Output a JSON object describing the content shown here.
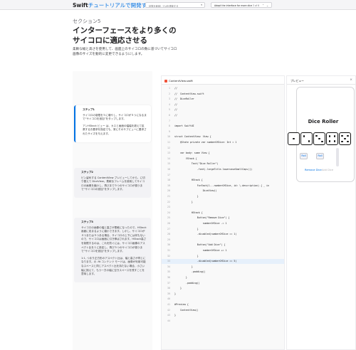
{
  "header": {
    "brand_bold": "Swift",
    "brand_rest": "チュートリアルで開発する",
    "search_placeholder": "状態を使用してUIを更新する",
    "step_title": "Adapt the interface for more dice",
    "step_count": "3 of 6",
    "prev_icon": "chevron-up-icon",
    "next_icon": "chevron-down-icon"
  },
  "section": {
    "label": "セクション5",
    "title": "インターフェースをより多くのサイコロに適応させる",
    "description": "柔軟な幅と高さを使用して、画面上のサイコロの数に基づいてサイコロ画像のサイズを動的に変更できるようにします。"
  },
  "steps": [
    {
      "title": "ステップ1",
      "paragraphs": [
        "サイコロの制限を５に増やし、サイコロが５つになるまで“サイコロを追加”をタップします。",
        "アンHStack ビュー は、カスと画面の幅幅を超えて拡張するお要求を指定でも、常にそのサブビューに要求されたサイズを与えます。"
      ]
    },
    {
      "title": "ステップ2",
      "paragraphs": [
        "ピン留めする ContentView プレビューしてから、に切り替えて DiceView。柔軟なフレームを使用してサイコロの画像を縮小し、再びまで５つのサイコロが揃うまで“サイコロの追加”をタップします。"
      ]
    },
    {
      "title": "ステップ3",
      "paragraphs": [
        "サイコロの画像の幅と高さが柔軟になったので、HStack画面に収まるように縮小できます。しかし、サイコロが４つまたは５つある場合、サイコロの上下には何もないので、サイコロは画面に引き伸ばされます。HStack高さを制限するのは、これを防ぐには、サイコロ画像のアスペクト比を１に設定し、再び５つのサイコロが揃うまで“サイコロを追加”をタップします。",
        "1:1, つまり正方形のアスペクト比は、幅と高さが同じになります。の .fit コンテンツ モードは、画像が利用可能なスペースと同じアスペクト比を持たない場合、小さい幅に揃えて、もう一方の幅に空きスペースを残すことを意味します。"
      ]
    }
  ],
  "editor": {
    "filename": "ContentView.swift",
    "lines": [
      {
        "n": "1",
        "code": "//"
      },
      {
        "n": "2",
        "code": "//  ContentView.swift"
      },
      {
        "n": "3",
        "code": "//  DiceRoller"
      },
      {
        "n": "4",
        "code": "//"
      },
      {
        "n": "5",
        "code": "//"
      },
      {
        "n": "6",
        "code": "//"
      },
      {
        "n": "7",
        "code": ""
      },
      {
        "n": "8",
        "code": "import SwiftUI"
      },
      {
        "n": "9",
        "code": ""
      },
      {
        "n": "10",
        "code": "struct ContentView: View {"
      },
      {
        "n": "11",
        "code": "    @State private var numberOfDice: Int = 1"
      },
      {
        "n": "12",
        "code": ""
      },
      {
        "n": "13",
        "code": "    var body: some View {"
      },
      {
        "n": "14",
        "code": "        VStack {"
      },
      {
        "n": "15",
        "code": "            Text(\"Dice Roller\")"
      },
      {
        "n": "16",
        "code": "                .font(.largeTitle.lowercaseSmallCaps())"
      },
      {
        "n": "17",
        "code": ""
      },
      {
        "n": "18",
        "code": "            HStack {"
      },
      {
        "n": "19",
        "code": "                ForEach(1...numberOfDice, id: \\.description) { _ in"
      },
      {
        "n": "20",
        "code": "                    DiceView()"
      },
      {
        "n": "21",
        "code": "                }"
      },
      {
        "n": "22",
        "code": "            }"
      },
      {
        "n": "23",
        "code": ""
      },
      {
        "n": "24",
        "code": "            HStack {"
      },
      {
        "n": "25",
        "code": "                Button(\"Remove Dice\") {"
      },
      {
        "n": "26",
        "code": "                    numberOfDice -= 1"
      },
      {
        "n": "27",
        "code": "                }"
      },
      {
        "n": "28",
        "code": "                .disabled(numberOfDice == 1)"
      },
      {
        "n": "29",
        "code": ""
      },
      {
        "n": "30",
        "code": "                Button(\"Add Dice\") {"
      },
      {
        "n": "31",
        "code": "                    numberOfDice += 1"
      },
      {
        "n": "32",
        "code": "                }"
      },
      {
        "n": "33",
        "code": "                .disabled(numberOfDice == 5)"
      },
      {
        "n": "34",
        "code": "            }"
      },
      {
        "n": "35",
        "code": "            .padding()"
      },
      {
        "n": "36",
        "code": "        }"
      },
      {
        "n": "37",
        "code": "        .padding()"
      },
      {
        "n": "38",
        "code": "    }"
      },
      {
        "n": "39",
        "code": "}"
      },
      {
        "n": "40",
        "code": ""
      },
      {
        "n": "41",
        "code": "#Preview {"
      },
      {
        "n": "42",
        "code": "    ContentView()"
      },
      {
        "n": "43",
        "code": "}"
      },
      {
        "n": "44",
        "code": ""
      }
    ],
    "highlighted_line": "33"
  },
  "preview": {
    "label": "プレビュー",
    "close_icon": "close-icon",
    "app_title": "Dice Roller",
    "dice_faces": [
      1,
      2,
      3,
      4,
      5
    ],
    "roll_label": "Roll",
    "remove_label": "Remove Dice",
    "add_label": "Add Dice"
  }
}
